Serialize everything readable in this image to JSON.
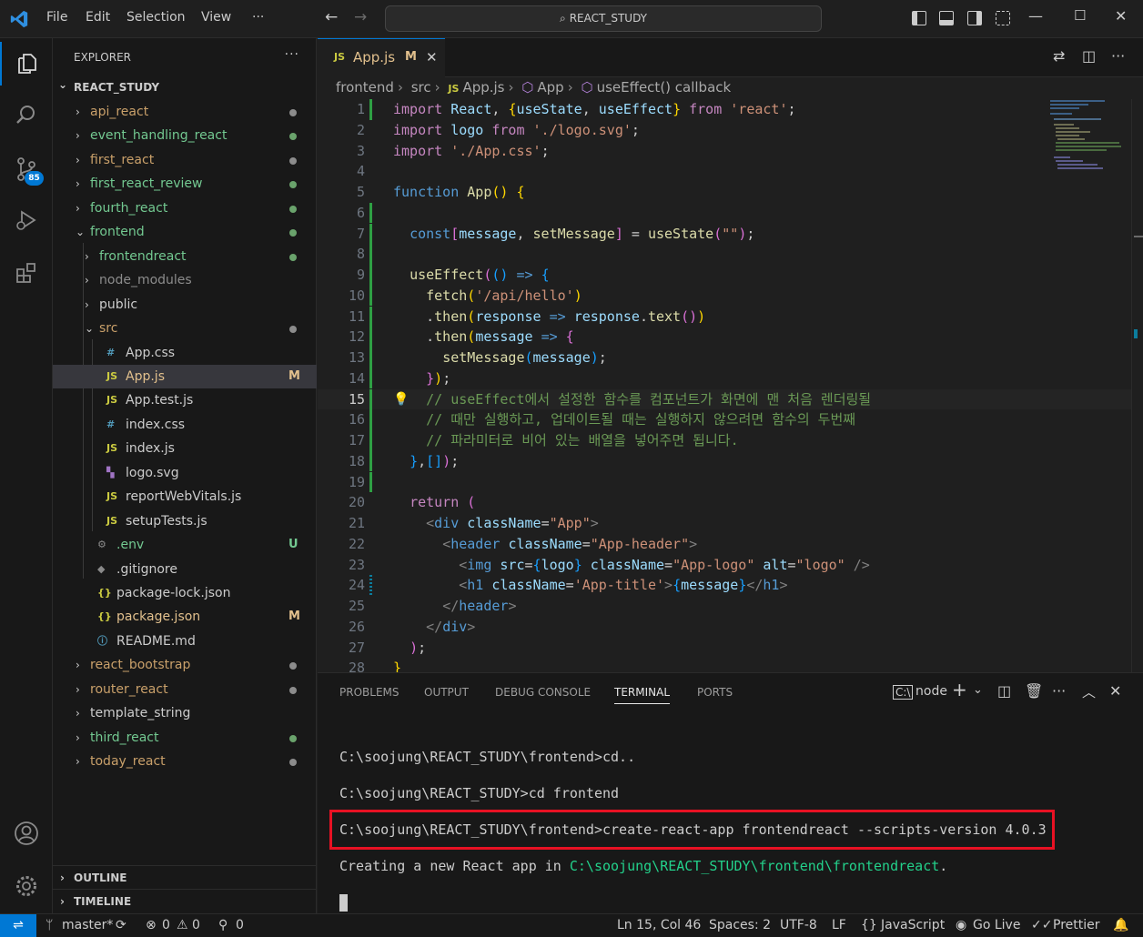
{
  "menu": [
    "File",
    "Edit",
    "Selection",
    "View",
    "···"
  ],
  "search": {
    "text": "REACT_STUDY"
  },
  "activity": {
    "scm_badge": "85"
  },
  "explorer": {
    "title": "EXPLORER",
    "root": "REACT_STUDY",
    "items": [
      {
        "label": "api_react",
        "color": "#c9a06a",
        "dot": "#8c8c8c"
      },
      {
        "label": "event_handling_react",
        "color": "#73c991",
        "dot": "#6aa36c"
      },
      {
        "label": "first_react",
        "color": "#c9a06a",
        "dot": "#8c8c8c"
      },
      {
        "label": "first_react_review",
        "color": "#73c991",
        "dot": "#6aa36c"
      },
      {
        "label": "fourth_react",
        "color": "#73c991",
        "dot": "#6aa36c"
      },
      {
        "label": "frontend",
        "color": "#73c991",
        "dot": "#6aa36c"
      },
      {
        "label": "frontendreact",
        "color": "#73c991",
        "dot": "#6aa36c"
      },
      {
        "label": "node_modules",
        "color": "#8c8c8c"
      },
      {
        "label": "public",
        "color": "#cccccc"
      },
      {
        "label": "src",
        "color": "#c9a06a",
        "dot": "#8c8c8c"
      },
      {
        "label": "App.css",
        "color": "#cccccc",
        "icon": "#"
      },
      {
        "label": "App.js",
        "color": "#e2c08d",
        "icon": "JS",
        "status": "M"
      },
      {
        "label": "App.test.js",
        "color": "#cccccc",
        "icon": "JS"
      },
      {
        "label": "index.css",
        "color": "#cccccc",
        "icon": "#"
      },
      {
        "label": "index.js",
        "color": "#cccccc",
        "icon": "JS"
      },
      {
        "label": "logo.svg",
        "color": "#cccccc",
        "icon": "svg"
      },
      {
        "label": "reportWebVitals.js",
        "color": "#cccccc",
        "icon": "JS"
      },
      {
        "label": "setupTests.js",
        "color": "#cccccc",
        "icon": "JS"
      },
      {
        "label": ".env",
        "color": "#73c991",
        "icon": "gear",
        "status": "U"
      },
      {
        "label": ".gitignore",
        "color": "#cccccc",
        "icon": "git"
      },
      {
        "label": "package-lock.json",
        "color": "#cccccc",
        "icon": "{}"
      },
      {
        "label": "package.json",
        "color": "#e2c08d",
        "icon": "{}",
        "status": "M"
      },
      {
        "label": "README.md",
        "color": "#cccccc",
        "icon": "info"
      },
      {
        "label": "react_bootstrap",
        "color": "#c9a06a",
        "dot": "#8c8c8c"
      },
      {
        "label": "router_react",
        "color": "#c9a06a",
        "dot": "#8c8c8c"
      },
      {
        "label": "template_string",
        "color": "#cccccc"
      },
      {
        "label": "third_react",
        "color": "#73c991",
        "dot": "#6aa36c"
      },
      {
        "label": "today_react",
        "color": "#c9a06a",
        "dot": "#8c8c8c"
      }
    ],
    "outline": "OUTLINE",
    "timeline": "TIMELINE"
  },
  "tab": {
    "icon": "JS",
    "label": "App.js",
    "status": "M"
  },
  "breadcrumb": [
    "frontend",
    "src",
    "App.js",
    "App",
    "useEffect() callback"
  ],
  "editor": {
    "line_numbers": [
      "1",
      "2",
      "3",
      "4",
      "5",
      "6",
      "7",
      "8",
      "9",
      "10",
      "11",
      "12",
      "13",
      "14",
      "15",
      "16",
      "17",
      "18",
      "19",
      "20",
      "21",
      "22",
      "23",
      "24",
      "25",
      "26",
      "27",
      "28"
    ]
  },
  "panel": {
    "tabs": [
      "PROBLEMS",
      "OUTPUT",
      "DEBUG CONSOLE",
      "TERMINAL",
      "PORTS"
    ],
    "terminal_name": "node",
    "lines": [
      "C:\\soojung\\REACT_STUDY\\frontend>cd..",
      "C:\\soojung\\REACT_STUDY>cd frontend",
      "C:\\soojung\\REACT_STUDY\\frontend>create-react-app frontendreact --scripts-version 4.0.3"
    ],
    "creating_prefix": "Creating a new React app in ",
    "creating_path": "C:\\soojung\\REACT_STUDY\\frontend\\frontendreact",
    "creating_suffix": "."
  },
  "status": {
    "branch": "master*",
    "errors": "0",
    "warnings": "0",
    "ports": "0",
    "position": "Ln 15, Col 46",
    "spaces": "Spaces: 2",
    "encoding": "UTF-8",
    "eol": "LF",
    "language": "JavaScript",
    "golive": "Go Live",
    "prettier": "Prettier"
  }
}
